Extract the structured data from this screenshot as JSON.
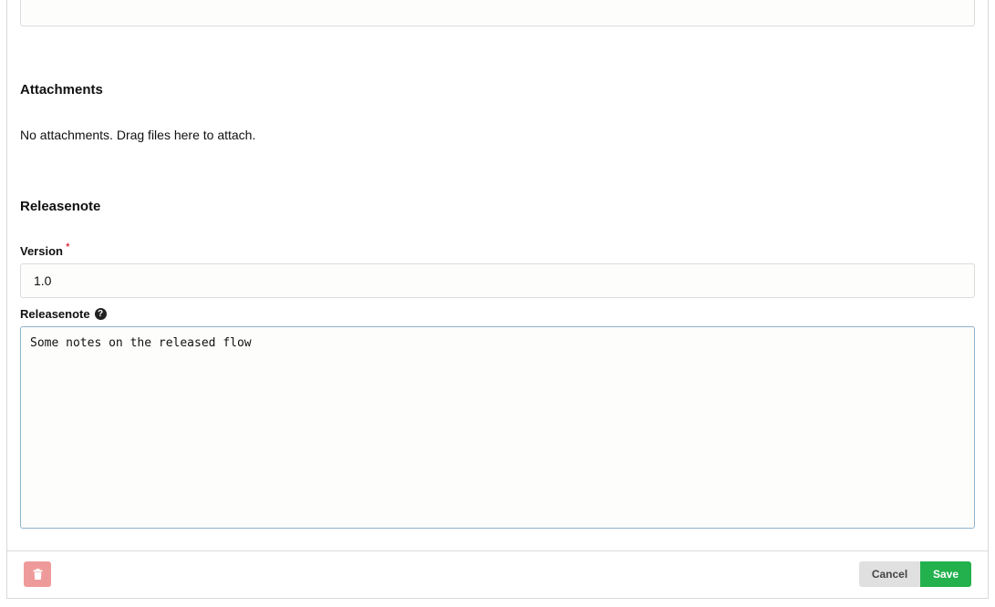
{
  "attachments": {
    "title": "Attachments",
    "empty_text": "No attachments. Drag files here to attach."
  },
  "releasenote_section": {
    "title": "Releasenote",
    "version_label": "Version",
    "required_marker": "*",
    "version_value": "1.0",
    "note_label": "Releasenote",
    "note_value": "Some notes on the released flow"
  },
  "footer": {
    "delete_icon": "trash-icon",
    "cancel_label": "Cancel",
    "save_label": "Save"
  },
  "colors": {
    "save": "#22b14c",
    "delete": "#ef9a9a",
    "required": "#d0021b"
  }
}
